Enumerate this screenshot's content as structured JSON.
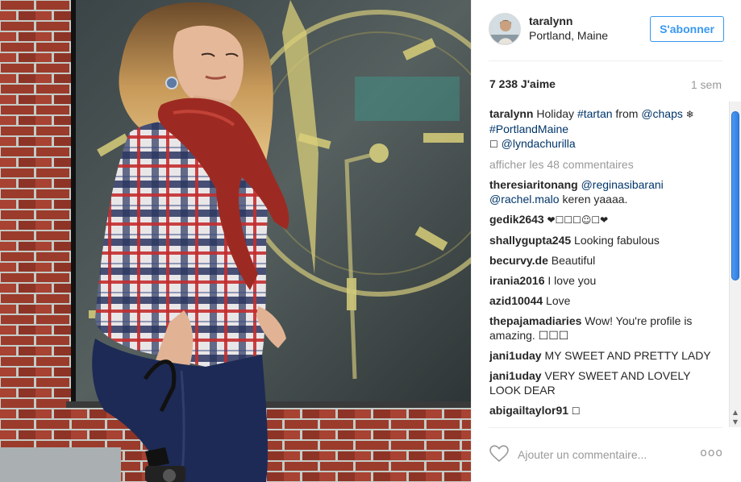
{
  "post": {
    "username": "taralynn",
    "location": "Portland, Maine",
    "follow_label": "S'abonner",
    "likes": "7 238 J'aime",
    "time_ago": "1 sem"
  },
  "caption": {
    "username": "taralynn",
    "text_1": " Holiday ",
    "hashtag_1": "#tartan",
    "text_2": " from ",
    "mention_1": "@chaps",
    "emoji_1": " ❄",
    "hashtag_2": "#PortlandMaine",
    "emoji_2": "☐",
    "mention_2": " @lyndachurilla"
  },
  "load_more_label": "afficher les 48 commentaires",
  "comments": [
    {
      "user": "theresiaritonang",
      "mentions": [
        "@reginasibarani",
        "@rachel.malo"
      ],
      "text": " keren yaaaa."
    },
    {
      "user": "gedik2643",
      "text": " ❤☐☐☐☺☐❤"
    },
    {
      "user": "shallygupta245",
      "text": " Looking fabulous"
    },
    {
      "user": "becurvy.de",
      "text": " Beautiful"
    },
    {
      "user": "irania2016",
      "text": " I love you"
    },
    {
      "user": "azid10044",
      "text": " Love"
    },
    {
      "user": "thepajamadiaries",
      "text": " Wow! You're profile is amazing. ☐☐☐"
    },
    {
      "user": "jani1uday",
      "text": " MY SWEET AND PRETTY LADY"
    },
    {
      "user": "jani1uday",
      "text": " VERY SWEET AND LOVELY LOOK DEAR"
    },
    {
      "user": "abigailtaylor91",
      "text": " ☐"
    }
  ],
  "footer": {
    "comment_placeholder": "Ajouter un commentaire...",
    "more_label": "ooo"
  },
  "colors": {
    "accent_blue": "#3897f0",
    "link_blue": "#003569",
    "muted_gray": "#999999",
    "scroll_thumb": "#3b8ceb"
  },
  "icons": {
    "like": "heart-outline-icon",
    "more": "more-options-icon",
    "scroll_up": "scroll-up-arrow-icon",
    "scroll_down": "scroll-down-arrow-icon"
  }
}
